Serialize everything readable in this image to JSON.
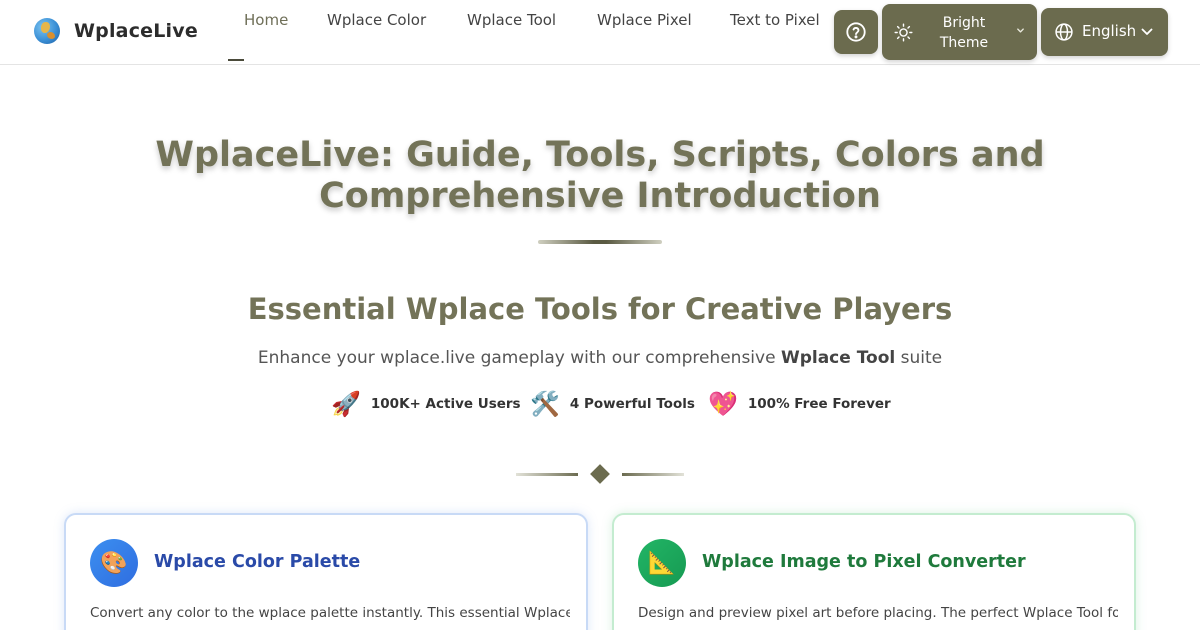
{
  "header": {
    "logo_text": "WplaceLive",
    "nav": [
      "Home",
      "Wplace Color",
      "Wplace Tool",
      "Wplace Pixel",
      "Text to Pixel"
    ],
    "active_nav": "Home",
    "theme_label": "Bright Theme",
    "language_label": "English",
    "accent_color": "#6b6b4e"
  },
  "hero": {
    "title": "WplaceLive: Guide, Tools, Scripts, Colors and Comprehensive Introduction"
  },
  "tools_section": {
    "title": "Essential Wplace Tools for Creative Players",
    "subtitle_prefix": "Enhance your wplace.live gameplay with our comprehensive ",
    "subtitle_bold": "Wplace Tool",
    "subtitle_suffix": " suite",
    "stats": [
      {
        "icon": "🚀",
        "icon_name": "rocket-icon",
        "label": "100K+ Active Users"
      },
      {
        "icon": "🛠️",
        "icon_name": "tools-icon",
        "label": "4 Powerful Tools"
      },
      {
        "icon": "💖",
        "icon_name": "heart-icon",
        "label": "100% Free Forever"
      }
    ]
  },
  "cards": [
    {
      "icon": "🎨",
      "icon_name": "palette-icon",
      "title": "Wplace Color Palette",
      "description": "Convert any color to the wplace palette instantly. This essential Wplace"
    },
    {
      "icon": "📐",
      "icon_name": "triangle-ruler-icon",
      "title": "Wplace Image to Pixel Converter",
      "description": "Design and preview pixel art before placing. The perfect Wplace Tool for"
    }
  ]
}
